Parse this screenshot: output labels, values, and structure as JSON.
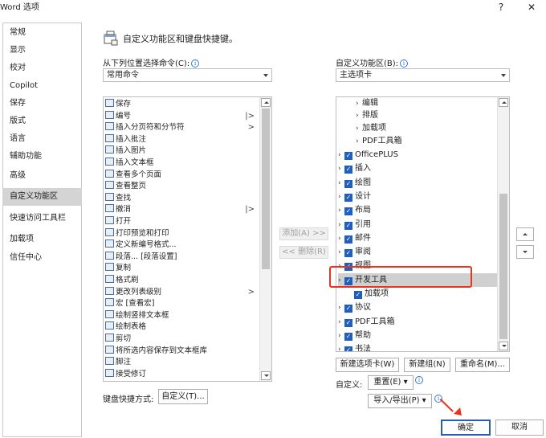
{
  "window": {
    "title": "Word 选项",
    "help": "?",
    "close": "✕"
  },
  "sidebar": {
    "items": [
      {
        "label": "常规"
      },
      {
        "label": "显示"
      },
      {
        "label": "校对"
      },
      {
        "label": "Copilot"
      },
      {
        "label": "保存"
      },
      {
        "label": "版式"
      },
      {
        "label": "语言"
      },
      {
        "label": "辅助功能"
      },
      {
        "label": "高级"
      },
      {
        "label": "自定义功能区"
      },
      {
        "label": "快速访问工具栏"
      },
      {
        "label": "加载项"
      },
      {
        "label": "信任中心"
      }
    ],
    "selected": "自定义功能区"
  },
  "header": {
    "text": "自定义功能区和键盘快捷键。"
  },
  "left": {
    "label": "从下列位置选择命令(C):",
    "combo_value": "常用命令",
    "items": [
      {
        "label": "保存",
        "sub": ""
      },
      {
        "label": "编号",
        "sub": "|>"
      },
      {
        "label": "插入分页符和分节符",
        "sub": ">"
      },
      {
        "label": "插入批注",
        "sub": ""
      },
      {
        "label": "插入图片",
        "sub": ""
      },
      {
        "label": "插入文本框",
        "sub": ""
      },
      {
        "label": "查看多个页面",
        "sub": ""
      },
      {
        "label": "查看整页",
        "sub": ""
      },
      {
        "label": "查找",
        "sub": ""
      },
      {
        "label": "撤消",
        "sub": "|>"
      },
      {
        "label": "打开",
        "sub": ""
      },
      {
        "label": "打印预览和打印",
        "sub": ""
      },
      {
        "label": "定义新编号格式...",
        "sub": ""
      },
      {
        "label": "段落... [段落设置]",
        "sub": ""
      },
      {
        "label": "复制",
        "sub": ""
      },
      {
        "label": "格式刷",
        "sub": ""
      },
      {
        "label": "更改列表级别",
        "sub": ">"
      },
      {
        "label": "宏 [查看宏]",
        "sub": ""
      },
      {
        "label": "绘制竖排文本框",
        "sub": ""
      },
      {
        "label": "绘制表格",
        "sub": ""
      },
      {
        "label": "剪切",
        "sub": ""
      },
      {
        "label": "将所选内容保存到文本框库",
        "sub": ""
      },
      {
        "label": "脚注",
        "sub": ""
      },
      {
        "label": "接受修订",
        "sub": ""
      }
    ]
  },
  "middle": {
    "add": "添加(A) >>",
    "remove": "<< 删除(R)"
  },
  "right": {
    "label": "自定义功能区(B):",
    "combo_value": "主选项卡",
    "items": [
      {
        "label": "编辑",
        "indent": 2,
        "checked": false
      },
      {
        "label": "排版",
        "indent": 2,
        "checked": false
      },
      {
        "label": "加载项",
        "indent": 2,
        "checked": false
      },
      {
        "label": "PDF工具箱",
        "indent": 2,
        "checked": false
      },
      {
        "label": "OfficePLUS",
        "indent": 1,
        "checked": true
      },
      {
        "label": "插入",
        "indent": 1,
        "checked": true
      },
      {
        "label": "绘图",
        "indent": 1,
        "checked": true
      },
      {
        "label": "设计",
        "indent": 1,
        "checked": true
      },
      {
        "label": "布局",
        "indent": 1,
        "checked": true
      },
      {
        "label": "引用",
        "indent": 1,
        "checked": true
      },
      {
        "label": "邮件",
        "indent": 1,
        "checked": true
      },
      {
        "label": "审阅",
        "indent": 1,
        "checked": true
      },
      {
        "label": "视图",
        "indent": 1,
        "checked": true
      },
      {
        "label": "开发工具",
        "indent": 1,
        "checked": true
      },
      {
        "label": "加载项",
        "indent": 0,
        "checked": true
      },
      {
        "label": "协议",
        "indent": 1,
        "checked": true
      },
      {
        "label": "PDF工具箱",
        "indent": 1,
        "checked": true
      },
      {
        "label": "帮助",
        "indent": 1,
        "checked": true
      },
      {
        "label": "书法",
        "indent": 1,
        "checked": true
      }
    ],
    "new_tab": "新建选项卡(W)",
    "new_group": "新建组(N)",
    "rename": "重命名(M)...",
    "customize_label": "自定义:",
    "reset": "重置(E) ▾",
    "import_export": "导入/导出(P) ▾"
  },
  "keyboard": {
    "label": "键盘快捷方式:",
    "button": "自定义(T)..."
  },
  "footer": {
    "ok": "确定",
    "cancel": "取消"
  },
  "accent": {
    "highlight": "#e8331f",
    "checkbox": "#1f5fbf"
  }
}
